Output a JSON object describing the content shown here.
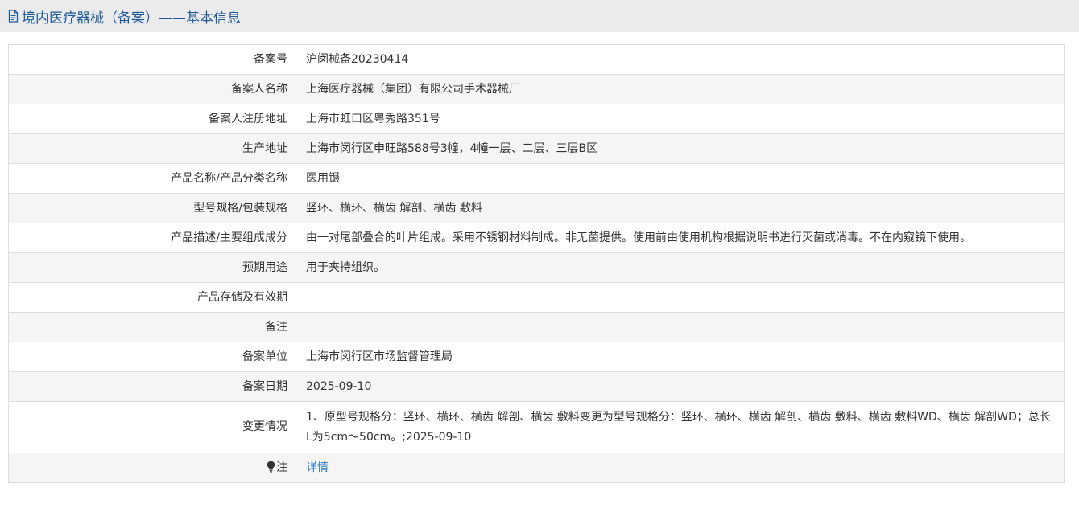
{
  "header": {
    "title": "境内医疗器械（备案）——基本信息",
    "icon": "document-icon"
  },
  "rows": [
    {
      "label": "备案号",
      "value": "沪闵械备20230414"
    },
    {
      "label": "备案人名称",
      "value": "上海医疗器械（集团）有限公司手术器械厂"
    },
    {
      "label": "备案人注册地址",
      "value": "上海市虹口区粤秀路351号"
    },
    {
      "label": "生产地址",
      "value": "上海市闵行区申旺路588号3幢，4幢一层、二层、三层B区"
    },
    {
      "label": "产品名称/产品分类名称",
      "value": "医用镊"
    },
    {
      "label": "型号规格/包装规格",
      "value": "竖环、横环、横齿 解剖、横齿 敷料"
    },
    {
      "label": "产品描述/主要组成成分",
      "value": "由一对尾部叠合的叶片组成。采用不锈钢材料制成。非无菌提供。使用前由使用机构根据说明书进行灭菌或消毒。不在内窥镜下使用。"
    },
    {
      "label": "预期用途",
      "value": "用于夹持组织。"
    },
    {
      "label": "产品存储及有效期",
      "value": ""
    },
    {
      "label": "备注",
      "value": ""
    },
    {
      "label": "备案单位",
      "value": "上海市闵行区市场监督管理局"
    },
    {
      "label": "备案日期",
      "value": "2025-09-10"
    },
    {
      "label": "变更情况",
      "value": "1、原型号规格分：竖环、横环、横齿 解剖、横齿 敷料变更为型号规格分：竖环、横环、横齿 解剖、横齿 敷料、横齿 敷料WD、横齿 解剖WD；总长L为5cm～50cm。;2025-09-10"
    }
  ],
  "note": {
    "label": "注",
    "icon": "lightbulb-icon",
    "link_text": "详情"
  },
  "colors": {
    "title": "#1e5a99",
    "link": "#2f7ec8",
    "header_bg": "#ebebeb",
    "row_alt_bg": "#f5f5f5",
    "border": "#dddddd"
  }
}
